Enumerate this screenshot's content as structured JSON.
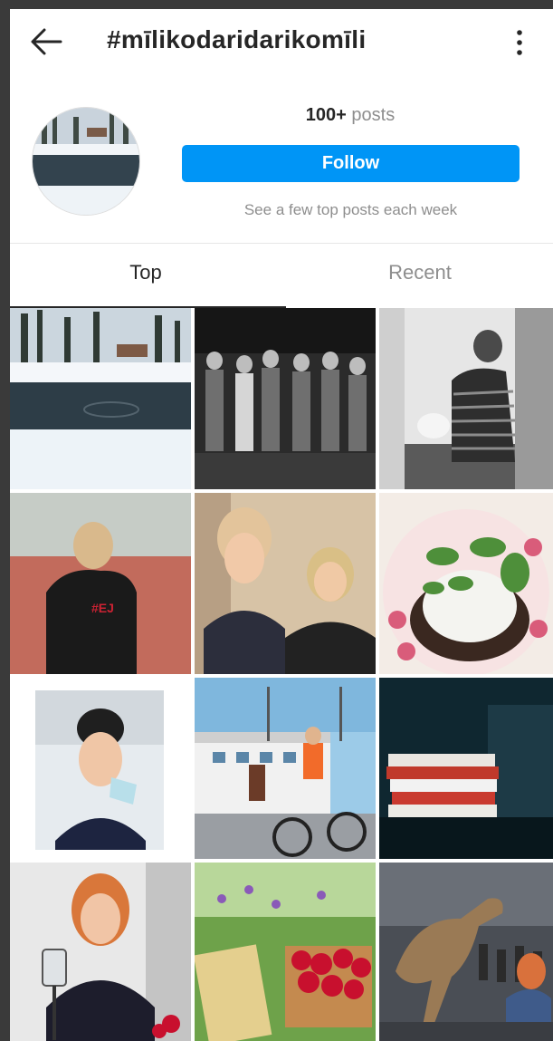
{
  "header": {
    "back_icon": "arrow-left-icon",
    "title": "#mīlikodaridarikomīli",
    "more_icon": "vertical-dots-icon"
  },
  "profile": {
    "posts_count": "100+",
    "posts_label": "posts",
    "follow_label": "Follow",
    "note": "See a few top posts each week"
  },
  "tabs": [
    {
      "label": "Top",
      "active": true
    },
    {
      "label": "Recent",
      "active": false
    }
  ],
  "colors": {
    "accent": "#0095f6",
    "text": "#262626",
    "muted": "#8e8e8e"
  },
  "grid": {
    "posts": [
      {
        "name": "post-winter-pond"
      },
      {
        "name": "post-dance-group-bw"
      },
      {
        "name": "post-striped-dress-bw"
      },
      {
        "name": "post-sport-hoodie"
      },
      {
        "name": "post-two-women-selfie"
      },
      {
        "name": "post-microgreens-plate"
      },
      {
        "name": "post-woman-mask-portrait"
      },
      {
        "name": "post-ship-bicycle"
      },
      {
        "name": "post-books-stack"
      },
      {
        "name": "post-redhead-phone"
      },
      {
        "name": "post-strawberries-book"
      },
      {
        "name": "post-dinosaur-model"
      }
    ]
  }
}
